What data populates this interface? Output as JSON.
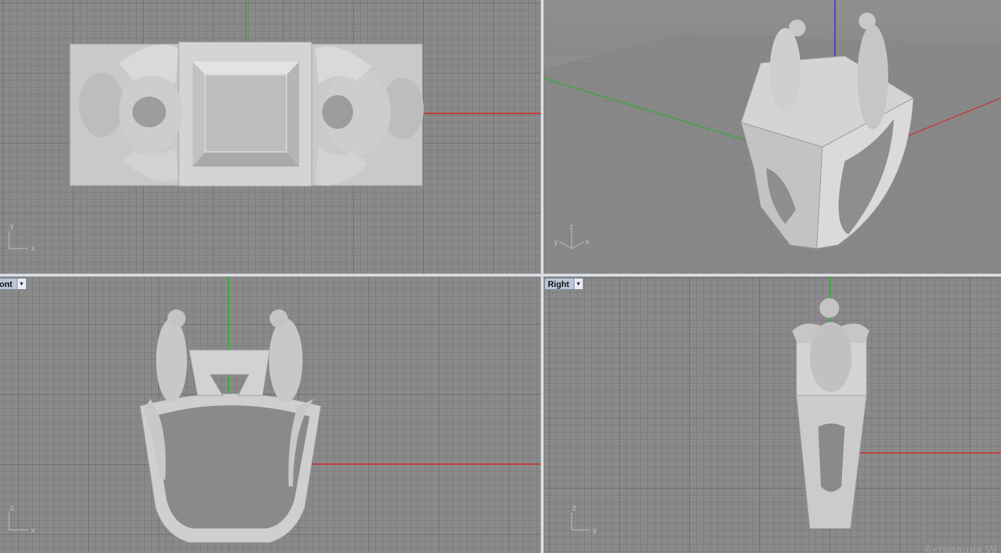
{
  "viewports": {
    "top": {
      "axes": {
        "a": "y",
        "b": "x"
      }
    },
    "perspective": {
      "axes": {
        "a": "z",
        "b": "y",
        "c": "x"
      }
    },
    "front": {
      "title": "ont",
      "axes": {
        "a": "z",
        "b": "x"
      }
    },
    "right": {
      "title": "Right",
      "axes": {
        "a": "z",
        "b": "y"
      }
    }
  },
  "watermark": "Активация W",
  "colors": {
    "viewport_bg": "#8a8a8a",
    "grid_major": "#6f6f6f",
    "grid_minor": "#7d7d7d",
    "axis_x": "#c43a3a",
    "axis_y": "#3aa83a",
    "axis_z": "#2b2bd8",
    "model": "#cfcfcf",
    "tab_bg": "#bcc7d6"
  },
  "icons": [
    "dropdown-arrow-icon",
    "axis-widget-icon"
  ]
}
